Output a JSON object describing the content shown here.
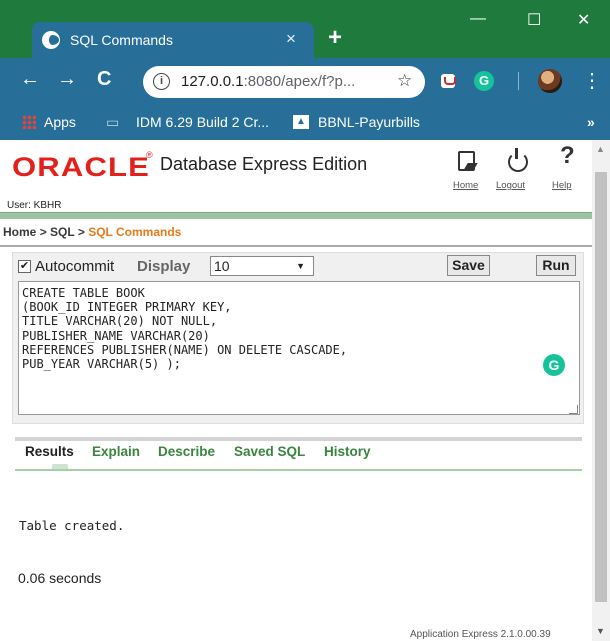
{
  "browser": {
    "tab_title": "SQL Commands",
    "tab_close": "×",
    "new_tab": "+",
    "window_controls": {
      "minimize": "—",
      "maximize": "☐",
      "close": "✕"
    },
    "nav": {
      "back": "←",
      "forward": "→",
      "reload": "C"
    },
    "url_host": "127.0.0.1",
    "url_rest": ":8080/apex/f?p...",
    "star": "☆",
    "extension_g": "G",
    "menu": "⋮",
    "bookmarks": [
      {
        "label": "Apps"
      },
      {
        "label": "IDM 6.29 Build 2 Cr..."
      },
      {
        "label": "BBNL-Payurbills"
      }
    ],
    "bookmarks_more": "»"
  },
  "header": {
    "logo_text": "ORACLE",
    "trademark": "®",
    "edition": "Database Express Edition",
    "links": {
      "home": "Home",
      "logout": "Logout",
      "help": "Help"
    },
    "help_glyph": "?",
    "user": "User: KBHR"
  },
  "breadcrumb": {
    "home": "Home",
    "sep": ">",
    "sql": "SQL",
    "current": "SQL Commands"
  },
  "command_panel": {
    "autocommit_checked": true,
    "autocommit_mark": "✔",
    "autocommit_label": "Autocommit",
    "display_label": "Display",
    "display_value": "10",
    "caret": "▼",
    "save_label": "Save",
    "run_label": "Run",
    "sql_text": "CREATE TABLE BOOK\n(BOOK_ID INTEGER PRIMARY KEY,\nTITLE VARCHAR(20) NOT NULL,\nPUBLISHER_NAME VARCHAR(20)\nREFERENCES PUBLISHER(NAME) ON DELETE CASCADE,\nPUB_YEAR VARCHAR(5) );",
    "grammarly": "G"
  },
  "results": {
    "tabs": [
      "Results",
      "Explain",
      "Describe",
      "Saved SQL",
      "History"
    ],
    "active_tab": "Results",
    "message": "Table created.",
    "time": "0.06 seconds"
  },
  "footer": "Application Express 2.1.0.00.39",
  "colors": {
    "oracle_red": "#e3201b",
    "chrome_blue": "#276f98",
    "window_green": "#1f7a3d",
    "tab_green": "#39843e",
    "breadcrumb_orange": "#e77a1a"
  }
}
